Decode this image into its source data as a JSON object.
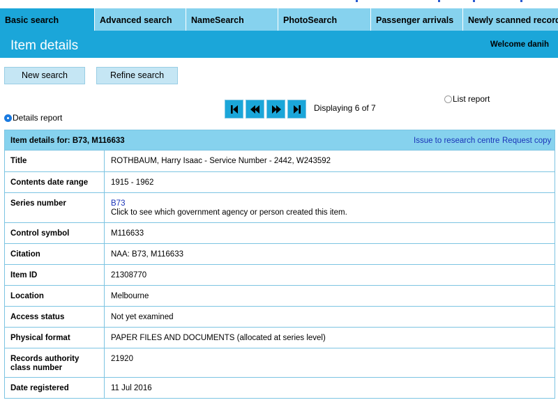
{
  "tabs": [
    {
      "label": "Basic search"
    },
    {
      "label": "Advanced search"
    },
    {
      "label": "NameSearch"
    },
    {
      "label": "PhotoSearch"
    },
    {
      "label": "Passenger arrivals"
    },
    {
      "label": "Newly scanned records"
    }
  ],
  "header": {
    "title": "Item details",
    "welcome": "Welcome danih"
  },
  "buttons": {
    "new_search": "New search",
    "refine_search": "Refine search"
  },
  "pager": {
    "first_icon": "first-page-icon",
    "prev_icon": "previous-icon",
    "next_icon": "next-icon",
    "last_icon": "last-page-icon",
    "status": "Displaying 6 of 7"
  },
  "report": {
    "list": "List report",
    "details": "Details report",
    "selected": "details"
  },
  "item": {
    "heading": "Item details for: B73, M116633",
    "issue_link": "Issue to research centre",
    "request_link": "Request copy",
    "rows": [
      {
        "key": "Title",
        "value": "ROTHBAUM, Harry Isaac - Service Number - 2442, W243592"
      },
      {
        "key": "Contents date range",
        "value": "1915 - 1962"
      },
      {
        "key": "Series number",
        "link": "B73",
        "value": "Click to see which government agency or person created this item."
      },
      {
        "key": "Control symbol",
        "value": "M116633"
      },
      {
        "key": "Citation",
        "value": "NAA: B73, M116633"
      },
      {
        "key": "Item ID",
        "value": "21308770"
      },
      {
        "key": "Location",
        "value": "Melbourne"
      },
      {
        "key": "Access status",
        "value": "Not yet examined"
      },
      {
        "key": "Physical format",
        "value": "PAPER FILES AND DOCUMENTS (allocated at series level)"
      },
      {
        "key": "Records authority class number",
        "value": "21920"
      },
      {
        "key": "Date registered",
        "value": "11 Jul 2016"
      }
    ]
  },
  "colors": {
    "primary": "#1ba6d9",
    "light": "#86d2ee",
    "button": "#c5e6f4",
    "link": "#1a33b8"
  }
}
